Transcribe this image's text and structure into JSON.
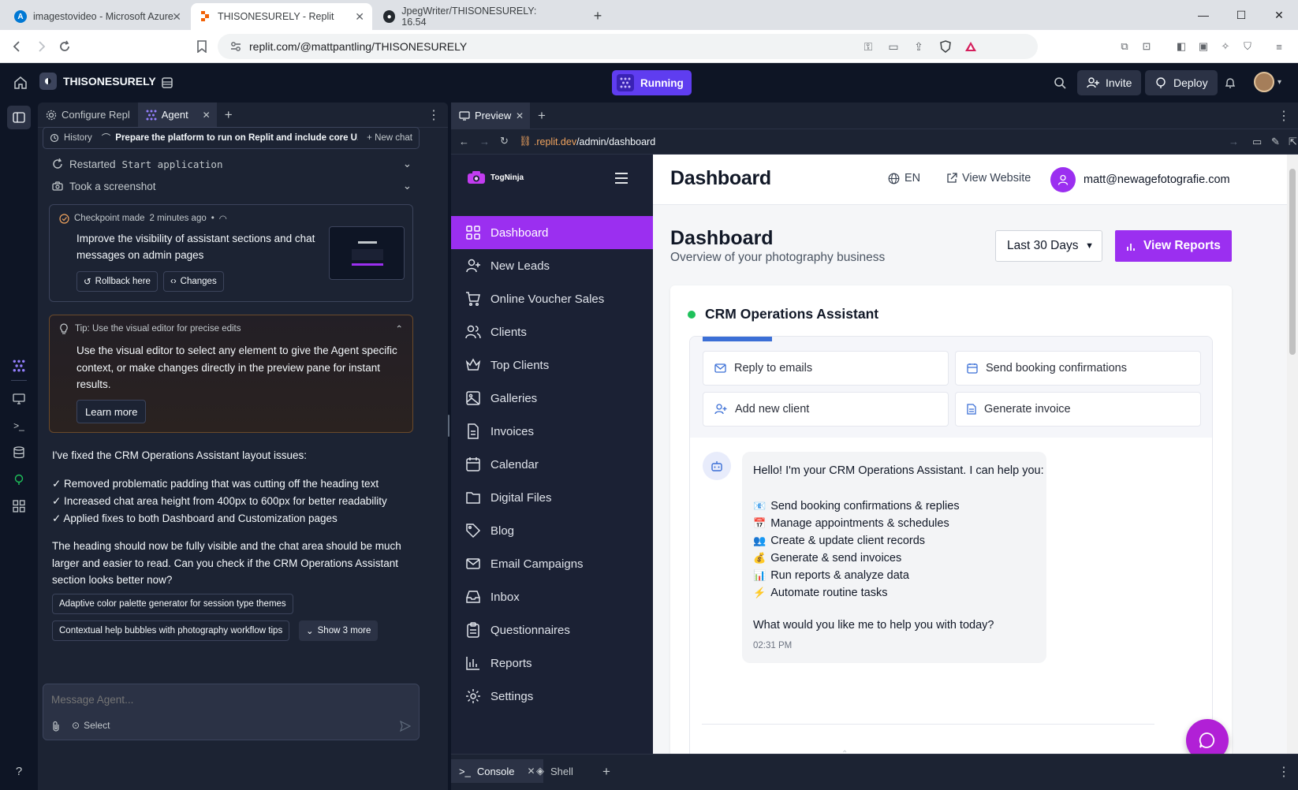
{
  "browser": {
    "tabs": [
      {
        "title": "imagestovideo - Microsoft Azure"
      },
      {
        "title": "THISONESURELY - Replit"
      },
      {
        "title": "JpegWriter/THISONESURELY: 16.54"
      }
    ],
    "url": "replit.com/@mattpantling/THISONESURELY"
  },
  "replit": {
    "repl_name": "THISONESURELY",
    "run_status": "Running",
    "invite_label": "Invite",
    "deploy_label": "Deploy"
  },
  "agent": {
    "tabs": [
      "Configure Repl",
      "Agent"
    ],
    "history_label": "History",
    "chat_title": "Prepare the platform to run on Replit and include core U...",
    "new_chat_label": "New chat",
    "events": [
      {
        "label": "Restarted",
        "code": "Start application"
      },
      {
        "label": "Took a screenshot"
      }
    ],
    "checkpoint": {
      "header": "Checkpoint made",
      "time": "2 minutes ago",
      "bullet": "•",
      "text": "Improve the visibility of assistant sections and chat messages on admin pages",
      "rollback_label": "Rollback here",
      "changes_label": "Changes"
    },
    "tip": {
      "title": "Tip: Use the visual editor for precise edits",
      "body": "Use the visual editor to select any element to give the Agent specific context, or make changes directly in the preview pane for instant results.",
      "learn_more": "Learn more"
    },
    "message": {
      "intro": "I've fixed the CRM Operations Assistant layout issues:",
      "bullets": [
        "✓ Removed problematic padding that was cutting off the heading text",
        "✓ Increased chat area height from 400px to 600px for better readability",
        "✓ Applied fixes to both Dashboard and Customization pages"
      ],
      "closing": "The heading should now be fully visible and the chat area should be much larger and easier to read. Can you check if the CRM Operations Assistant section looks better now?"
    },
    "suggestions": [
      "Adaptive color palette generator for session type themes",
      "Contextual help bubbles with photography workflow tips"
    ],
    "show_more": "Show 3 more",
    "input_placeholder": "Message Agent...",
    "select_label": "Select"
  },
  "preview": {
    "tab_label": "Preview",
    "url_prefix": ".replit.dev",
    "url_path": "/admin/dashboard",
    "bottom_tabs": [
      "Console",
      "Shell"
    ]
  },
  "site": {
    "logo_text": "TogNinja",
    "nav": [
      {
        "label": "Dashboard",
        "icon": "grid-icon",
        "active": true
      },
      {
        "label": "New Leads",
        "icon": "user-plus-icon"
      },
      {
        "label": "Online Voucher Sales",
        "icon": "cart-icon"
      },
      {
        "label": "Clients",
        "icon": "users-icon"
      },
      {
        "label": "Top Clients",
        "icon": "crown-icon"
      },
      {
        "label": "Galleries",
        "icon": "image-icon"
      },
      {
        "label": "Invoices",
        "icon": "file-icon"
      },
      {
        "label": "Calendar",
        "icon": "calendar-icon"
      },
      {
        "label": "Digital Files",
        "icon": "folder-icon"
      },
      {
        "label": "Blog",
        "icon": "tag-icon"
      },
      {
        "label": "Email Campaigns",
        "icon": "mail-icon"
      },
      {
        "label": "Inbox",
        "icon": "inbox-icon"
      },
      {
        "label": "Questionnaires",
        "icon": "clipboard-icon"
      },
      {
        "label": "Reports",
        "icon": "bar-chart-icon"
      },
      {
        "label": "Settings",
        "icon": "gear-icon"
      }
    ],
    "topbar": {
      "title": "Dashboard",
      "language": "EN",
      "view_website": "View Website",
      "user_email": "matt@newagefotografie.com"
    },
    "page": {
      "title": "Dashboard",
      "subtitle": "Overview of your photography business",
      "range_select": "Last 30 Days",
      "view_reports": "View Reports"
    },
    "assistant": {
      "title": "CRM Operations Assistant",
      "quick_actions": [
        {
          "label": "Reply to emails",
          "icon": "mail-icon"
        },
        {
          "label": "Send booking confirmations",
          "icon": "calendar-icon"
        },
        {
          "label": "Add new client",
          "icon": "user-plus-icon"
        },
        {
          "label": "Generate invoice",
          "icon": "file-icon"
        }
      ],
      "greeting": "Hello! I'm your CRM Operations Assistant. I can help you:",
      "capabilities": [
        {
          "emoji": "📧",
          "text": "Send booking confirmations & replies"
        },
        {
          "emoji": "📅",
          "text": "Manage appointments & schedules"
        },
        {
          "emoji": "👥",
          "text": "Create & update client records"
        },
        {
          "emoji": "💰",
          "text": "Generate & send invoices"
        },
        {
          "emoji": "📊",
          "text": "Run reports & analyze data"
        },
        {
          "emoji": "⚡",
          "text": "Automate routine tasks"
        }
      ],
      "question": "What would you like me to help you with today?",
      "time": "02:31 PM"
    }
  },
  "colors": {
    "replit_bg": "#0e1525",
    "panel_bg": "#1c2333",
    "accent_purple": "#9b2ff0",
    "running_purple": "#5f3df0",
    "status_green": "#1fc15b"
  }
}
